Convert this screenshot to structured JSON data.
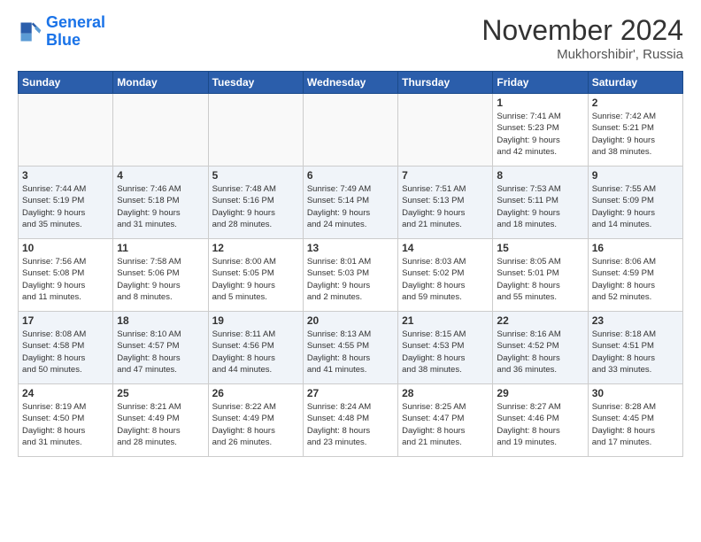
{
  "logo": {
    "line1": "General",
    "line2": "Blue"
  },
  "title": "November 2024",
  "location": "Mukhorshibir', Russia",
  "weekdays": [
    "Sunday",
    "Monday",
    "Tuesday",
    "Wednesday",
    "Thursday",
    "Friday",
    "Saturday"
  ],
  "weeks": [
    [
      {
        "day": "",
        "info": ""
      },
      {
        "day": "",
        "info": ""
      },
      {
        "day": "",
        "info": ""
      },
      {
        "day": "",
        "info": ""
      },
      {
        "day": "",
        "info": ""
      },
      {
        "day": "1",
        "info": "Sunrise: 7:41 AM\nSunset: 5:23 PM\nDaylight: 9 hours\nand 42 minutes."
      },
      {
        "day": "2",
        "info": "Sunrise: 7:42 AM\nSunset: 5:21 PM\nDaylight: 9 hours\nand 38 minutes."
      }
    ],
    [
      {
        "day": "3",
        "info": "Sunrise: 7:44 AM\nSunset: 5:19 PM\nDaylight: 9 hours\nand 35 minutes."
      },
      {
        "day": "4",
        "info": "Sunrise: 7:46 AM\nSunset: 5:18 PM\nDaylight: 9 hours\nand 31 minutes."
      },
      {
        "day": "5",
        "info": "Sunrise: 7:48 AM\nSunset: 5:16 PM\nDaylight: 9 hours\nand 28 minutes."
      },
      {
        "day": "6",
        "info": "Sunrise: 7:49 AM\nSunset: 5:14 PM\nDaylight: 9 hours\nand 24 minutes."
      },
      {
        "day": "7",
        "info": "Sunrise: 7:51 AM\nSunset: 5:13 PM\nDaylight: 9 hours\nand 21 minutes."
      },
      {
        "day": "8",
        "info": "Sunrise: 7:53 AM\nSunset: 5:11 PM\nDaylight: 9 hours\nand 18 minutes."
      },
      {
        "day": "9",
        "info": "Sunrise: 7:55 AM\nSunset: 5:09 PM\nDaylight: 9 hours\nand 14 minutes."
      }
    ],
    [
      {
        "day": "10",
        "info": "Sunrise: 7:56 AM\nSunset: 5:08 PM\nDaylight: 9 hours\nand 11 minutes."
      },
      {
        "day": "11",
        "info": "Sunrise: 7:58 AM\nSunset: 5:06 PM\nDaylight: 9 hours\nand 8 minutes."
      },
      {
        "day": "12",
        "info": "Sunrise: 8:00 AM\nSunset: 5:05 PM\nDaylight: 9 hours\nand 5 minutes."
      },
      {
        "day": "13",
        "info": "Sunrise: 8:01 AM\nSunset: 5:03 PM\nDaylight: 9 hours\nand 2 minutes."
      },
      {
        "day": "14",
        "info": "Sunrise: 8:03 AM\nSunset: 5:02 PM\nDaylight: 8 hours\nand 59 minutes."
      },
      {
        "day": "15",
        "info": "Sunrise: 8:05 AM\nSunset: 5:01 PM\nDaylight: 8 hours\nand 55 minutes."
      },
      {
        "day": "16",
        "info": "Sunrise: 8:06 AM\nSunset: 4:59 PM\nDaylight: 8 hours\nand 52 minutes."
      }
    ],
    [
      {
        "day": "17",
        "info": "Sunrise: 8:08 AM\nSunset: 4:58 PM\nDaylight: 8 hours\nand 50 minutes."
      },
      {
        "day": "18",
        "info": "Sunrise: 8:10 AM\nSunset: 4:57 PM\nDaylight: 8 hours\nand 47 minutes."
      },
      {
        "day": "19",
        "info": "Sunrise: 8:11 AM\nSunset: 4:56 PM\nDaylight: 8 hours\nand 44 minutes."
      },
      {
        "day": "20",
        "info": "Sunrise: 8:13 AM\nSunset: 4:55 PM\nDaylight: 8 hours\nand 41 minutes."
      },
      {
        "day": "21",
        "info": "Sunrise: 8:15 AM\nSunset: 4:53 PM\nDaylight: 8 hours\nand 38 minutes."
      },
      {
        "day": "22",
        "info": "Sunrise: 8:16 AM\nSunset: 4:52 PM\nDaylight: 8 hours\nand 36 minutes."
      },
      {
        "day": "23",
        "info": "Sunrise: 8:18 AM\nSunset: 4:51 PM\nDaylight: 8 hours\nand 33 minutes."
      }
    ],
    [
      {
        "day": "24",
        "info": "Sunrise: 8:19 AM\nSunset: 4:50 PM\nDaylight: 8 hours\nand 31 minutes."
      },
      {
        "day": "25",
        "info": "Sunrise: 8:21 AM\nSunset: 4:49 PM\nDaylight: 8 hours\nand 28 minutes."
      },
      {
        "day": "26",
        "info": "Sunrise: 8:22 AM\nSunset: 4:49 PM\nDaylight: 8 hours\nand 26 minutes."
      },
      {
        "day": "27",
        "info": "Sunrise: 8:24 AM\nSunset: 4:48 PM\nDaylight: 8 hours\nand 23 minutes."
      },
      {
        "day": "28",
        "info": "Sunrise: 8:25 AM\nSunset: 4:47 PM\nDaylight: 8 hours\nand 21 minutes."
      },
      {
        "day": "29",
        "info": "Sunrise: 8:27 AM\nSunset: 4:46 PM\nDaylight: 8 hours\nand 19 minutes."
      },
      {
        "day": "30",
        "info": "Sunrise: 8:28 AM\nSunset: 4:45 PM\nDaylight: 8 hours\nand 17 minutes."
      }
    ]
  ]
}
